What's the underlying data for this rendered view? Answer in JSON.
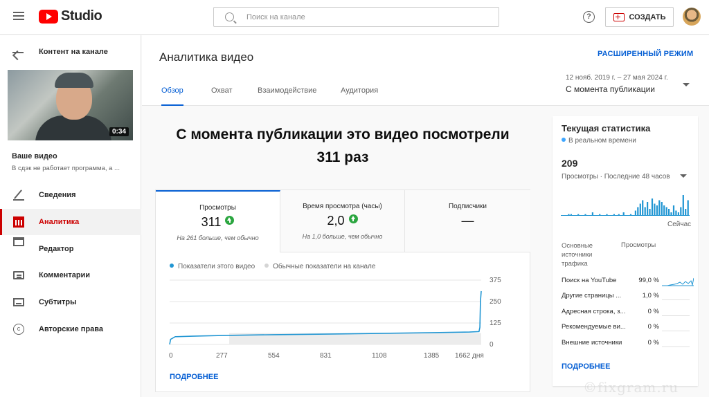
{
  "topbar": {
    "logo_text": "Studio",
    "search_placeholder": "Поиск на канале",
    "help_glyph": "?",
    "create_label": "СОЗДАТЬ"
  },
  "sidebar": {
    "back_label": "Контент на канале",
    "thumb_duration": "0:34",
    "your_video": "Ваше видео",
    "video_title": "В сдэк не работает программа, а ...",
    "items": [
      {
        "label": "Сведения",
        "icon": "pencil-icon"
      },
      {
        "label": "Аналитика",
        "icon": "analytics-icon",
        "active": true
      },
      {
        "label": "Редактор",
        "icon": "editor-icon"
      },
      {
        "label": "Комментарии",
        "icon": "comments-icon"
      },
      {
        "label": "Субтитры",
        "icon": "subtitles-icon"
      },
      {
        "label": "Авторские права",
        "icon": "copyright-icon"
      }
    ],
    "copyright_glyph": "c"
  },
  "header": {
    "title": "Аналитика видео",
    "advanced_label": "РАСШИРЕННЫЙ РЕЖИМ",
    "tabs": [
      "Обзор",
      "Охват",
      "Взаимодействие",
      "Аудитория"
    ],
    "date_range": "12 нояб. 2019 г. – 27 мая 2024 г.",
    "date_select": "С момента публикации"
  },
  "main": {
    "headline_line1": "С момента публикации это видео посмотрели",
    "headline_line2": "311 раз",
    "metrics": [
      {
        "label": "Просмотры",
        "value": "311",
        "sub": "На 261 больше, чем обычно",
        "trend": "up"
      },
      {
        "label": "Время просмотра (часы)",
        "value": "2,0",
        "sub": "На 1,0 больше, чем обычно",
        "trend": "up"
      },
      {
        "label": "Подписчики",
        "value": "—",
        "sub": ""
      }
    ],
    "legend_this": "Показатели этого видео",
    "legend_typical": "Обычные показатели на канале",
    "more_label": "ПОДРОБНЕЕ"
  },
  "chart_data": {
    "type": "line",
    "x_tick_labels": [
      "0",
      "277",
      "554",
      "831",
      "1108",
      "1385",
      "1662 дня"
    ],
    "y_tick_labels": [
      "375",
      "250",
      "125",
      "0"
    ],
    "ylim": [
      0,
      375
    ],
    "xlim": [
      0,
      1662
    ],
    "series": [
      {
        "name": "Показатели этого видео",
        "color": "#2196d3",
        "x": [
          0,
          5,
          30,
          120,
          277,
          554,
          831,
          1108,
          1385,
          1600,
          1650,
          1655,
          1658,
          1662
        ],
        "y": [
          0,
          30,
          45,
          48,
          52,
          57,
          60,
          64,
          68,
          72,
          75,
          100,
          250,
          311
        ]
      },
      {
        "name": "Обычные показатели на канале",
        "color": "#d5d5d5",
        "x": [
          0,
          1662
        ],
        "y": [
          50,
          50
        ]
      }
    ]
  },
  "realtime": {
    "title": "Текущая статистика",
    "live_label": "В реальном времени",
    "count": "209",
    "period": "Просмотры · Последние 48 часов",
    "now_label": "Сейчас",
    "sources_header": "Основные источники трафика",
    "views_header": "Просмотры",
    "sources": [
      {
        "name": "Поиск на YouTube",
        "pct": "99,0 %"
      },
      {
        "name": "Другие страницы ...",
        "pct": "1,0 %"
      },
      {
        "name": "Адресная строка, з...",
        "pct": "0 %"
      },
      {
        "name": "Рекомендуемые ви...",
        "pct": "0 %"
      },
      {
        "name": "Внешние источники",
        "pct": "0 %"
      }
    ],
    "bars_48h": [
      0,
      0,
      0,
      1,
      1,
      0,
      0,
      1,
      0,
      0,
      1,
      0,
      0,
      2,
      0,
      0,
      1,
      0,
      0,
      1,
      0,
      0,
      1,
      0,
      1,
      0,
      2,
      0,
      0,
      1,
      0,
      3,
      5,
      7,
      9,
      5,
      8,
      4,
      10,
      7,
      6,
      9,
      8,
      6,
      5,
      4,
      2,
      6,
      3,
      2,
      5,
      12,
      4,
      9
    ],
    "more_label": "ПОДРОБНЕЕ",
    "bar_color": "#2196d3"
  },
  "watermark": "©fixgram.ru"
}
